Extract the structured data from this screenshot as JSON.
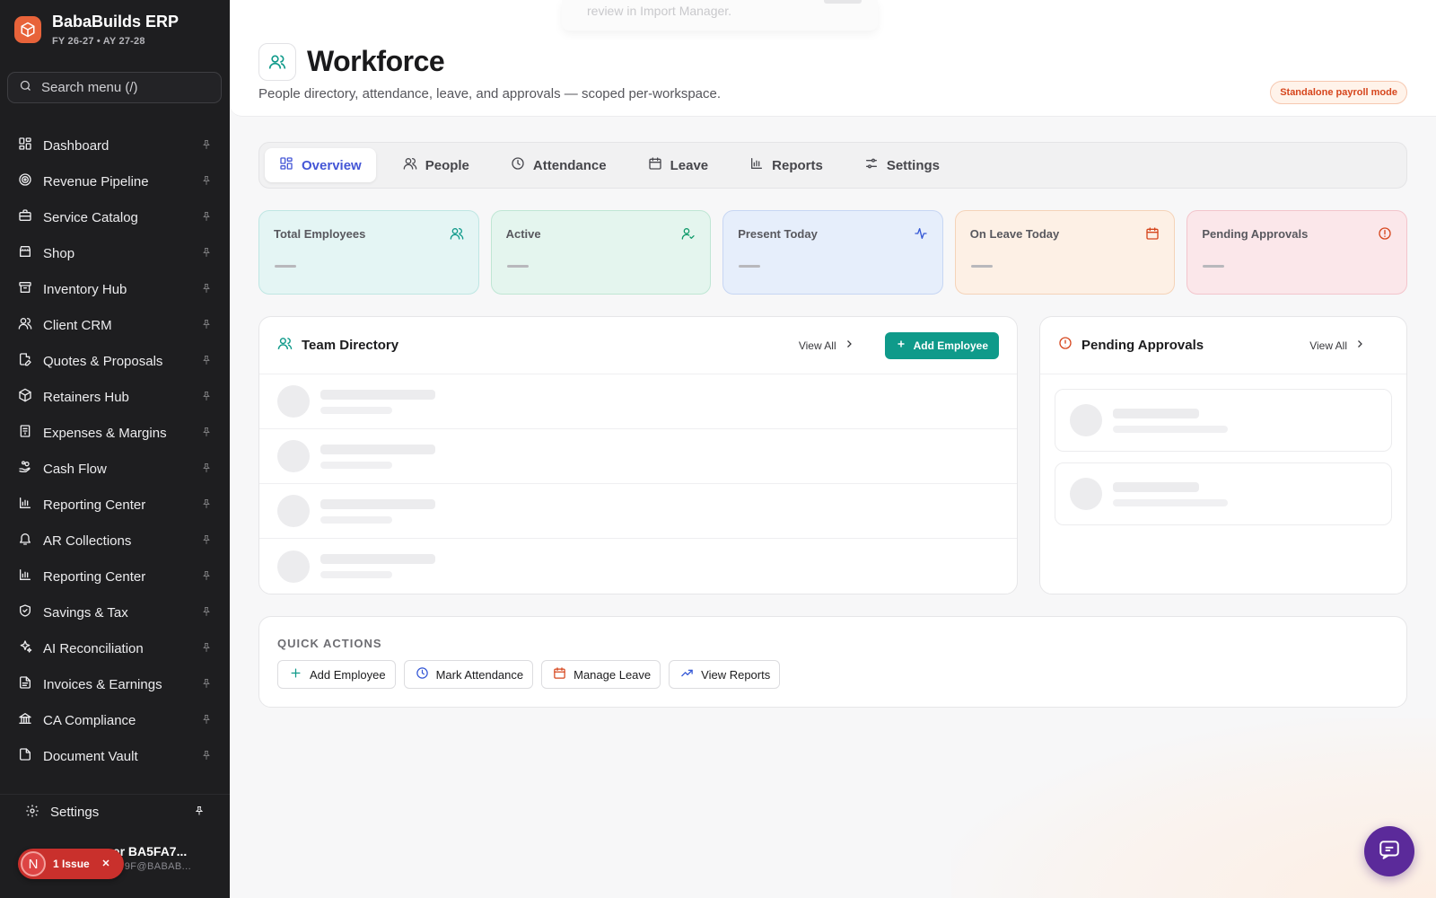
{
  "brand": {
    "name": "BabaBuilds ERP",
    "subtitle": "FY 26-27 • AY 27-28",
    "icon": "cube-icon"
  },
  "search": {
    "placeholder": "Search menu (/)"
  },
  "sidebar": {
    "items": [
      {
        "label": "Dashboard",
        "icon": "dashboard-icon"
      },
      {
        "label": "Revenue Pipeline",
        "icon": "target-icon"
      },
      {
        "label": "Service Catalog",
        "icon": "briefcase-icon"
      },
      {
        "label": "Shop",
        "icon": "shop-icon"
      },
      {
        "label": "Inventory Hub",
        "icon": "archive-icon"
      },
      {
        "label": "Client CRM",
        "icon": "users-icon"
      },
      {
        "label": "Quotes & Proposals",
        "icon": "file-edit-icon"
      },
      {
        "label": "Retainers Hub",
        "icon": "box-icon"
      },
      {
        "label": "Expenses & Margins",
        "icon": "receipt-icon"
      },
      {
        "label": "Cash Flow",
        "icon": "hand-coins-icon"
      },
      {
        "label": "Reporting Center",
        "icon": "bar-chart-icon"
      },
      {
        "label": "AR Collections",
        "icon": "bell-icon"
      },
      {
        "label": "Reporting Center",
        "icon": "bar-chart-icon"
      },
      {
        "label": "Savings & Tax",
        "icon": "shield-icon"
      },
      {
        "label": "AI Reconciliation",
        "icon": "sparkles-icon"
      },
      {
        "label": "Invoices & Earnings",
        "icon": "file-text-icon"
      },
      {
        "label": "CA Compliance",
        "icon": "landmark-icon"
      },
      {
        "label": "Document Vault",
        "icon": "document-icon"
      }
    ],
    "settings_label": "Settings"
  },
  "user": {
    "name": "ser BA5FA7...",
    "email": "FA79F@BABAB..."
  },
  "issue": {
    "avatar_letter": "N",
    "label": "1 Issue"
  },
  "toast": {
    "text": "review in Import Manager."
  },
  "header": {
    "title": "Workforce",
    "description": "People directory, attendance, leave, and approvals — scoped per-workspace.",
    "badge": "Standalone payroll mode"
  },
  "tabs": [
    {
      "label": "Overview",
      "icon": "grid-icon",
      "active": true
    },
    {
      "label": "People",
      "icon": "users-icon",
      "active": false
    },
    {
      "label": "Attendance",
      "icon": "clock-icon",
      "active": false
    },
    {
      "label": "Leave",
      "icon": "calendar-icon",
      "active": false
    },
    {
      "label": "Reports",
      "icon": "bar-chart-icon",
      "active": false
    },
    {
      "label": "Settings",
      "icon": "sliders-icon",
      "active": false
    }
  ],
  "stats": [
    {
      "label": "Total Employees",
      "icon": "users-icon",
      "color": "#0f9a8a"
    },
    {
      "label": "Active",
      "icon": "user-check-icon",
      "color": "#0f9a6a"
    },
    {
      "label": "Present Today",
      "icon": "activity-icon",
      "color": "#3558d6"
    },
    {
      "label": "On Leave Today",
      "icon": "calendar-icon",
      "color": "#d6461d"
    },
    {
      "label": "Pending Approvals",
      "icon": "alert-circle-icon",
      "color": "#d6461d"
    }
  ],
  "team": {
    "title": "Team Directory",
    "view_all": "View All",
    "add_label": "Add Employee"
  },
  "pending": {
    "title": "Pending Approvals",
    "view_all": "View All"
  },
  "quick_actions": {
    "title": "QUICK ACTIONS",
    "buttons": [
      {
        "label": "Add Employee",
        "icon": "plus-icon",
        "color": "#0f9a8a"
      },
      {
        "label": "Mark Attendance",
        "icon": "clock-icon",
        "color": "#3558d6"
      },
      {
        "label": "Manage Leave",
        "icon": "calendar-icon",
        "color": "#d6461d"
      },
      {
        "label": "View Reports",
        "icon": "trending-up-icon",
        "color": "#3558d6"
      }
    ]
  },
  "colors": {
    "accent": "#4456d6",
    "teal": "#0f9a8a",
    "chat": "#5b2a9a",
    "brand": "#e8633a"
  }
}
